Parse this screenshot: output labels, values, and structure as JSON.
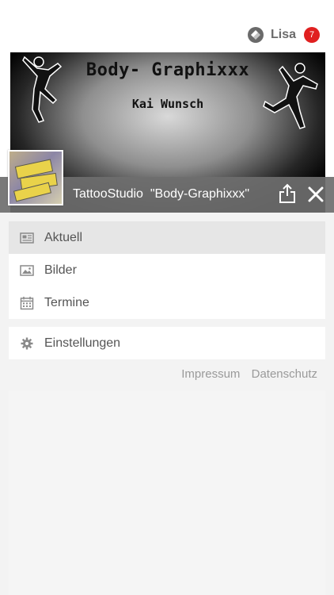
{
  "user": {
    "name": "Lisa",
    "notification_count": "7"
  },
  "banner": {
    "title": "Body- Graphixxx",
    "subtitle": "Kai Wunsch"
  },
  "page": {
    "title": "TattooStudio  \"Body-Graphixxx\""
  },
  "menu": {
    "items": [
      {
        "label": "Aktuell",
        "icon": "newspaper-icon",
        "active": true
      },
      {
        "label": "Bilder",
        "icon": "image-icon",
        "active": false
      },
      {
        "label": "Termine",
        "icon": "calendar-icon",
        "active": false
      }
    ],
    "settings": {
      "label": "Einstellungen",
      "icon": "gear-icon"
    }
  },
  "footer": {
    "impressum": "Impressum",
    "datenschutz": "Datenschutz"
  },
  "colors": {
    "badge": "#e02020",
    "titlebar": "#6e6e6e"
  }
}
